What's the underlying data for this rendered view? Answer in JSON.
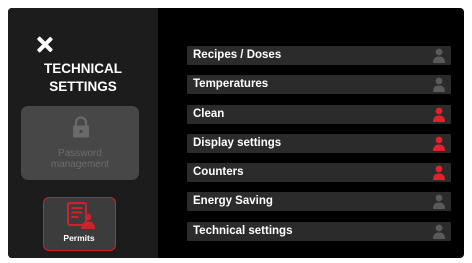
{
  "sidebar": {
    "title_line1": "TECHNICAL",
    "title_line2": "SETTINGS",
    "password_label_line1": "Password",
    "password_label_line2": "management",
    "permits_label": "Permits"
  },
  "menu": {
    "items": [
      {
        "label": "Recipes / Doses",
        "icon": "user-icon",
        "status": "inactive"
      },
      {
        "label": "Temperatures",
        "icon": "user-icon",
        "status": "inactive"
      },
      {
        "label": "Clean",
        "icon": "user-icon",
        "status": "active"
      },
      {
        "label": "Display settings",
        "icon": "user-icon",
        "status": "active"
      },
      {
        "label": "Counters",
        "icon": "user-icon",
        "status": "active"
      },
      {
        "label": "Energy Saving",
        "icon": "user-icon",
        "status": "inactive"
      },
      {
        "label": "Technical settings",
        "icon": "user-icon",
        "status": "inactive"
      }
    ]
  },
  "colors": {
    "accent": "#d0202a",
    "user_icon_inactive": "#5a5a5a",
    "user_icon_active": "#e3202c",
    "background": "#000000",
    "sidebar": "#1c1c1c",
    "menu_item": "#2b2b2b"
  }
}
